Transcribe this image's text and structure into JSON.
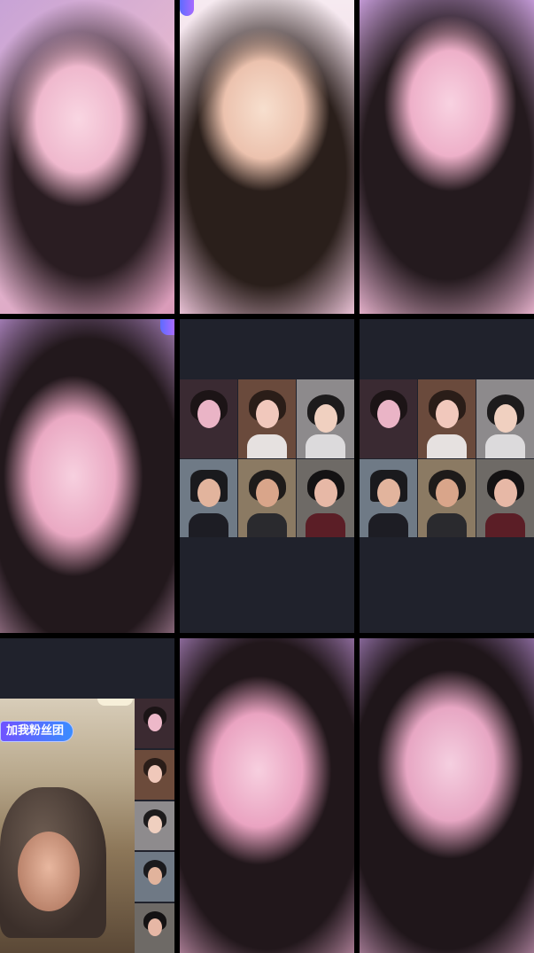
{
  "feed": {
    "fan_club_badge": "加我粉丝团",
    "pk_labels": [
      "",
      ""
    ]
  },
  "colors": {
    "background": "#000000",
    "dark_cell": "#20222c",
    "badge_gradient_start": "#6f53ff",
    "badge_gradient_end": "#3a8dff"
  },
  "icons": {
    "badge": "fan-club-badge"
  }
}
